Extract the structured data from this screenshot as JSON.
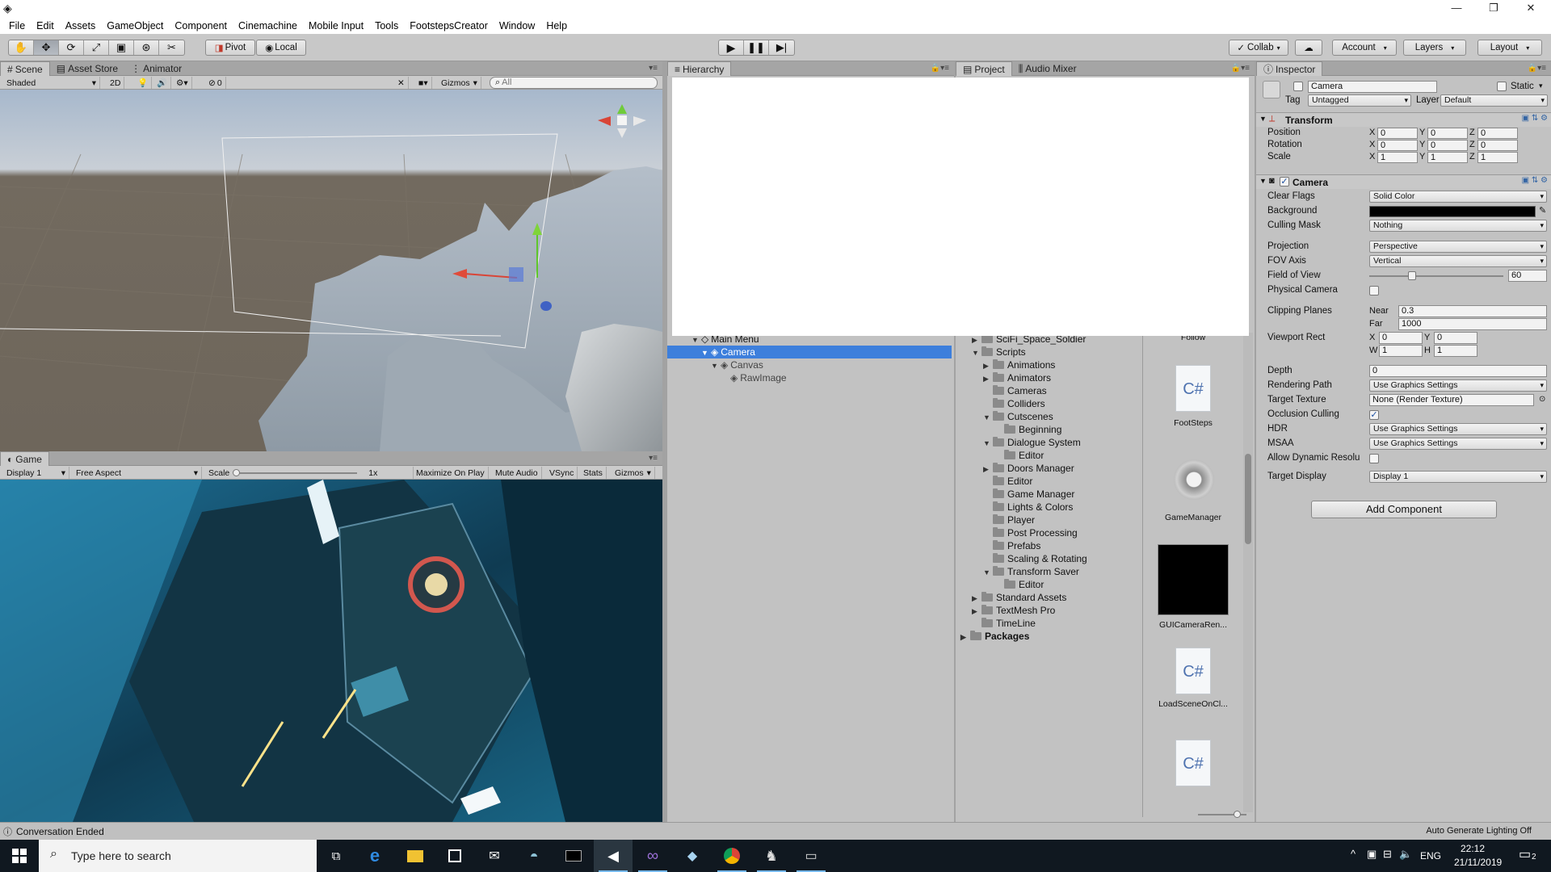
{
  "window": {
    "minimize": "—",
    "restore": "❐",
    "close": "✕"
  },
  "menu": [
    "File",
    "Edit",
    "Assets",
    "GameObject",
    "Component",
    "Cinemachine",
    "Mobile Input",
    "Tools",
    "FootstepsCreator",
    "Window",
    "Help"
  ],
  "toolbar": {
    "pivot": "Pivot",
    "local": "Local",
    "collab": "Collab",
    "account": "Account",
    "layers": "Layers",
    "layout": "Layout",
    "tools": [
      "hand-tool",
      "move-tool",
      "rotate-tool",
      "scale-tool",
      "rect-tool",
      "transform-tool",
      "custom-tool"
    ]
  },
  "scene": {
    "tabs": [
      "Scene",
      "Asset Store",
      "Animator"
    ],
    "shading": "Shaded",
    "mode2d": "2D",
    "effects_count": "0",
    "gizmos": "Gizmos",
    "search_placeholder": "All"
  },
  "game": {
    "tab": "Game",
    "display": "Display 1",
    "aspect": "Free Aspect",
    "scale_label": "Scale",
    "scale_value": "1x",
    "maximize": "Maximize On Play",
    "mute": "Mute Audio",
    "vsync": "VSync",
    "stats": "Stats",
    "gizmos": "Gizmos"
  },
  "hierarchy": {
    "tab": "Hierarchy",
    "items": [
      {
        "label": "Main Menu",
        "level": 0
      },
      {
        "label": "Camera",
        "level": 1,
        "selected": true
      },
      {
        "label": "Canvas",
        "level": 2
      },
      {
        "label": "RawImage",
        "level": 3
      }
    ]
  },
  "project": {
    "tabs": [
      "Project",
      "Audio Mixer"
    ],
    "tree": [
      {
        "label": "SciFi_Space_Soldier",
        "level": 1,
        "arrow": "▶"
      },
      {
        "label": "Scripts",
        "level": 1,
        "arrow": "▼"
      },
      {
        "label": "Animations",
        "level": 2,
        "arrow": "▶"
      },
      {
        "label": "Animators",
        "level": 2,
        "arrow": "▶"
      },
      {
        "label": "Cameras",
        "level": 2,
        "arrow": ""
      },
      {
        "label": "Colliders",
        "level": 2,
        "arrow": ""
      },
      {
        "label": "Cutscenes",
        "level": 2,
        "arrow": "▼"
      },
      {
        "label": "Beginning",
        "level": 3,
        "arrow": ""
      },
      {
        "label": "Dialogue System",
        "level": 2,
        "arrow": "▼"
      },
      {
        "label": "Editor",
        "level": 3,
        "arrow": ""
      },
      {
        "label": "Doors Manager",
        "level": 2,
        "arrow": "▶"
      },
      {
        "label": "Editor",
        "level": 2,
        "arrow": ""
      },
      {
        "label": "Game Manager",
        "level": 2,
        "arrow": ""
      },
      {
        "label": "Lights & Colors",
        "level": 2,
        "arrow": ""
      },
      {
        "label": "Player",
        "level": 2,
        "arrow": ""
      },
      {
        "label": "Post Processing",
        "level": 2,
        "arrow": ""
      },
      {
        "label": "Prefabs",
        "level": 2,
        "arrow": ""
      },
      {
        "label": "Scaling & Rotating",
        "level": 2,
        "arrow": ""
      },
      {
        "label": "Transform Saver",
        "level": 2,
        "arrow": "▼"
      },
      {
        "label": "Editor",
        "level": 3,
        "arrow": ""
      },
      {
        "label": "Standard Assets",
        "level": 1,
        "arrow": "▶"
      },
      {
        "label": "TextMesh Pro",
        "level": 1,
        "arrow": "▶"
      },
      {
        "label": "TimeLine",
        "level": 1,
        "arrow": ""
      },
      {
        "label": "Packages",
        "level": 0,
        "arrow": "▶",
        "bold": true
      }
    ],
    "assets": [
      "Follow",
      "FootSteps",
      "GameManager",
      "GUICameraRen...",
      "LoadSceneOnCl...",
      ""
    ]
  },
  "inspector": {
    "tab": "Inspector",
    "object_name": "Camera",
    "static_label": "Static",
    "tag_label": "Tag",
    "tag_value": "Untagged",
    "layer_label": "Layer",
    "layer_value": "Default",
    "transform": {
      "title": "Transform",
      "position": {
        "label": "Position",
        "x": "0",
        "y": "0",
        "z": "0"
      },
      "rotation": {
        "label": "Rotation",
        "x": "0",
        "y": "0",
        "z": "0"
      },
      "scale": {
        "label": "Scale",
        "x": "1",
        "y": "1",
        "z": "1"
      }
    },
    "camera": {
      "title": "Camera",
      "clear_flags": {
        "label": "Clear Flags",
        "value": "Solid Color"
      },
      "background": {
        "label": "Background",
        "color": "#000000"
      },
      "culling_mask": {
        "label": "Culling Mask",
        "value": "Nothing"
      },
      "projection": {
        "label": "Projection",
        "value": "Perspective"
      },
      "fov_axis": {
        "label": "FOV Axis",
        "value": "Vertical"
      },
      "fov": {
        "label": "Field of View",
        "value": "60",
        "fraction": 0.32
      },
      "physical": {
        "label": "Physical Camera"
      },
      "clipping": {
        "label": "Clipping Planes",
        "near_label": "Near",
        "near": "0.3",
        "far_label": "Far",
        "far": "1000"
      },
      "viewport": {
        "label": "Viewport Rect",
        "x": "0",
        "y": "0",
        "w": "1",
        "h": "1"
      },
      "depth": {
        "label": "Depth",
        "value": "0"
      },
      "rendering_path": {
        "label": "Rendering Path",
        "value": "Use Graphics Settings"
      },
      "target_texture": {
        "label": "Target Texture",
        "value": "None (Render Texture)"
      },
      "occlusion": {
        "label": "Occlusion Culling"
      },
      "hdr": {
        "label": "HDR",
        "value": "Use Graphics Settings"
      },
      "msaa": {
        "label": "MSAA",
        "value": "Use Graphics Settings"
      },
      "dynamic": {
        "label": "Allow Dynamic Resolu"
      },
      "target_display": {
        "label": "Target Display",
        "value": "Display 1"
      }
    },
    "add_component": "Add Component"
  },
  "status": {
    "message": "Conversation Ended",
    "right": "Auto Generate Lighting Off"
  },
  "taskbar": {
    "search_placeholder": "Type here to search",
    "lang": "ENG",
    "time": "22:12",
    "date": "21/11/2019",
    "notif": "2"
  }
}
